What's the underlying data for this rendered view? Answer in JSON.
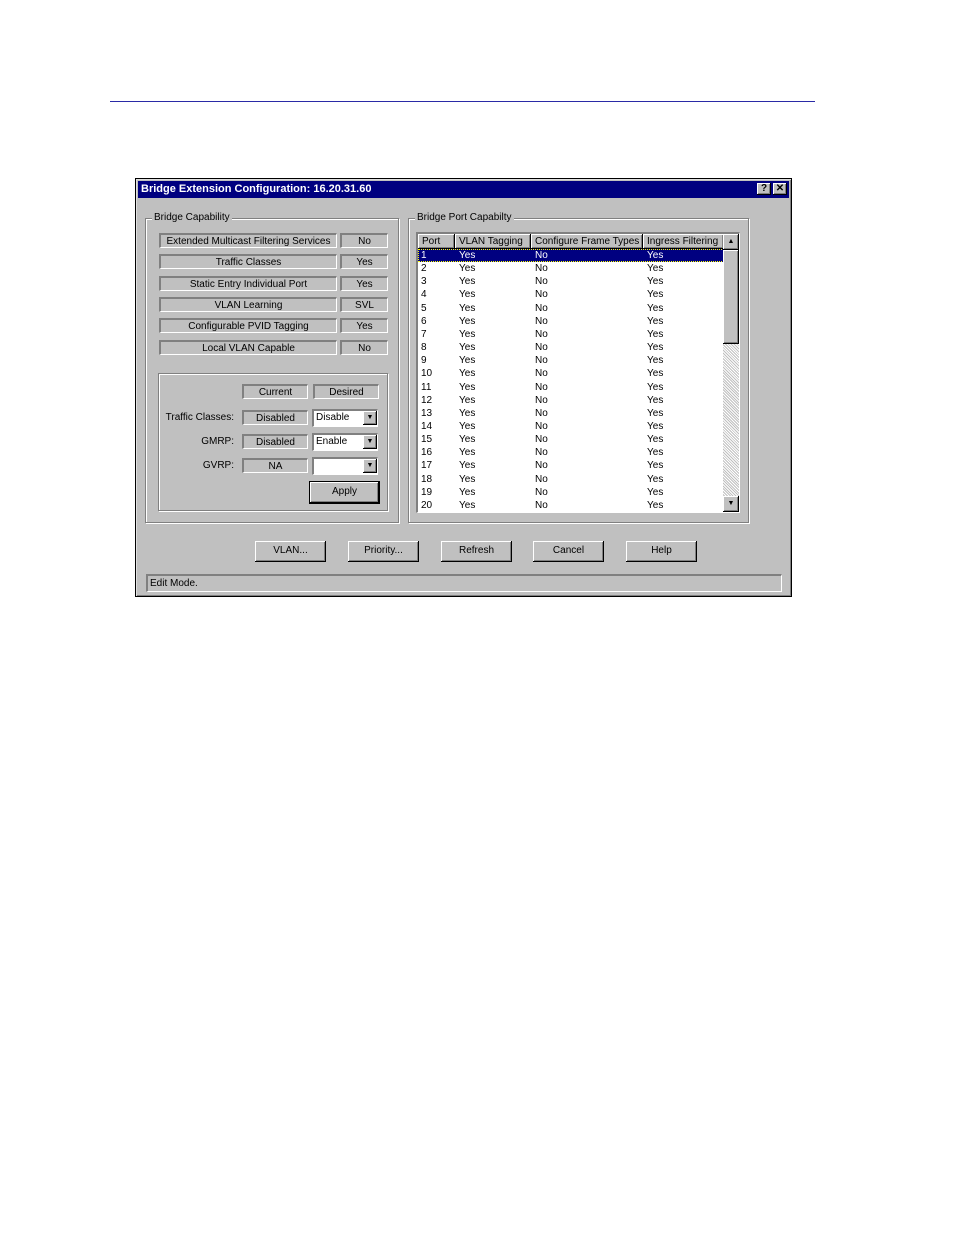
{
  "window": {
    "title": "Bridge Extension Configuration: 16.20.31.60",
    "help_btn": "?",
    "close_btn": "✕"
  },
  "bridge_capability": {
    "legend": "Bridge Capability",
    "items": [
      {
        "label": "Extended Multicast Filtering Services",
        "value": "No"
      },
      {
        "label": "Traffic Classes",
        "value": "Yes"
      },
      {
        "label": "Static Entry Individual Port",
        "value": "Yes"
      },
      {
        "label": "VLAN Learning",
        "value": "SVL"
      },
      {
        "label": "Configurable PVID Tagging",
        "value": "Yes"
      },
      {
        "label": "Local VLAN Capable",
        "value": "No"
      }
    ],
    "settings": {
      "current_header": "Current",
      "desired_header": "Desired",
      "rows": [
        {
          "label": "Traffic Classes:",
          "current": "Disabled",
          "desired": "Disable"
        },
        {
          "label": "GMRP:",
          "current": "Disabled",
          "desired": "Enable"
        },
        {
          "label": "GVRP:",
          "current": "NA",
          "desired": ""
        }
      ],
      "apply_label": "Apply"
    }
  },
  "port_capability": {
    "legend": "Bridge Port Capabilty",
    "columns": [
      "Port",
      "VLAN Tagging",
      "Configure Frame Types",
      "Ingress Filtering"
    ],
    "selected_row": 0,
    "rows": [
      [
        "1",
        "Yes",
        "No",
        "Yes"
      ],
      [
        "2",
        "Yes",
        "No",
        "Yes"
      ],
      [
        "3",
        "Yes",
        "No",
        "Yes"
      ],
      [
        "4",
        "Yes",
        "No",
        "Yes"
      ],
      [
        "5",
        "Yes",
        "No",
        "Yes"
      ],
      [
        "6",
        "Yes",
        "No",
        "Yes"
      ],
      [
        "7",
        "Yes",
        "No",
        "Yes"
      ],
      [
        "8",
        "Yes",
        "No",
        "Yes"
      ],
      [
        "9",
        "Yes",
        "No",
        "Yes"
      ],
      [
        "10",
        "Yes",
        "No",
        "Yes"
      ],
      [
        "11",
        "Yes",
        "No",
        "Yes"
      ],
      [
        "12",
        "Yes",
        "No",
        "Yes"
      ],
      [
        "13",
        "Yes",
        "No",
        "Yes"
      ],
      [
        "14",
        "Yes",
        "No",
        "Yes"
      ],
      [
        "15",
        "Yes",
        "No",
        "Yes"
      ],
      [
        "16",
        "Yes",
        "No",
        "Yes"
      ],
      [
        "17",
        "Yes",
        "No",
        "Yes"
      ],
      [
        "18",
        "Yes",
        "No",
        "Yes"
      ],
      [
        "19",
        "Yes",
        "No",
        "Yes"
      ],
      [
        "20",
        "Yes",
        "No",
        "Yes"
      ]
    ]
  },
  "buttons": {
    "vlan": "VLAN...",
    "priority": "Priority...",
    "refresh": "Refresh",
    "cancel": "Cancel",
    "help": "Help"
  },
  "status": "Edit Mode.",
  "icons": {
    "scroll_up": "▲",
    "scroll_down": "▼",
    "dropdown": "▼"
  }
}
